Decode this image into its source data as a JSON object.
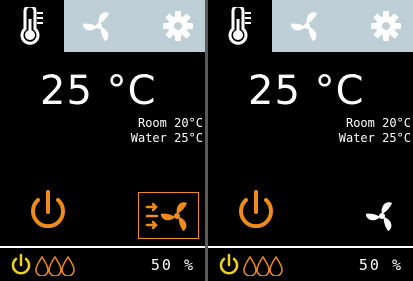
{
  "panels": [
    {
      "temperature": "25 °C",
      "room": "Room 20°C",
      "water": "Water 25°C",
      "fan_mode": "auto-fan",
      "fan_active": true,
      "percent": "50 %"
    },
    {
      "temperature": "25 °C",
      "room": "Room 20°C",
      "water": "Water 25°C",
      "fan_mode": "fan",
      "fan_active": false,
      "percent": "50 %"
    }
  ],
  "tabs": [
    "thermometer-icon",
    "fan-icon",
    "gear-icon"
  ],
  "colors": {
    "accent": "#f08a1c",
    "status_yellow": "#f2d21b",
    "tab_strip": "#bfcfd8",
    "background": "#000000",
    "text": "#ffffff"
  }
}
